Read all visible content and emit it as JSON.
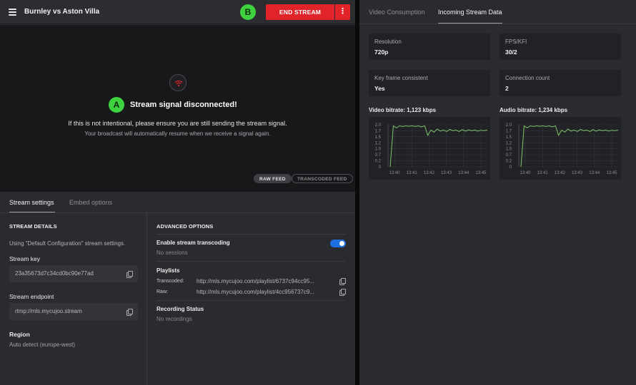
{
  "header": {
    "title": "Burnley vs Aston Villa",
    "badge_b": "B",
    "end_stream_label": "END STREAM",
    "more_label": "⋮"
  },
  "video": {
    "badge_a": "A",
    "title": "Stream signal disconnected!",
    "line1": "If this is not intentional, please ensure you are still sending the stream signal.",
    "line2": "Your broadcast will automatically resume when we receive a signal again.",
    "raw_feed": "RAW FEED",
    "transcoded_feed": "TRANSCODED FEED"
  },
  "left_tabs": [
    "Stream settings",
    "Embed options"
  ],
  "stream_details": {
    "heading": "STREAM DETAILS",
    "config_text": "Using \"Default Configuration\" stream settings.",
    "key_label": "Stream key",
    "key_value": "23a35673d7c34cd0bc90e77ad",
    "endpoint_label": "Stream endpoint",
    "endpoint_value": "rtmp://mls.mycujoo.stream",
    "region_label": "Region",
    "region_value": "Auto detect (europe-west)"
  },
  "advanced": {
    "heading": "ADVANCED OPTIONS",
    "transcoding_label": "Enable stream transcoding",
    "transcoding_enabled": true,
    "sessions": "No sessions",
    "playlists_label": "Playlists",
    "transcoded_label": "Transcoded:",
    "transcoded_url": "http://mls.mycujoo.com/playlist/6737c94cc95...",
    "raw_label": "Raw:",
    "raw_url": "http://mls.mycujoo.com/playlist/4cc956737c9...",
    "recording_label": "Recording Status",
    "recording_value": "No recordings"
  },
  "right_tabs": [
    "Video Consumption",
    "Incoming Stream Data"
  ],
  "stats": [
    {
      "label": "Resolution",
      "value": "720p"
    },
    {
      "label": "FPS/KFI",
      "value": "30/2"
    },
    {
      "label": "Key frame consistent",
      "value": "Yes"
    },
    {
      "label": "Connection count",
      "value": "2"
    }
  ],
  "colors": {
    "accent_red": "#e0242a",
    "badge_green": "#3ed23e",
    "toggle_blue": "#1e6fe0",
    "chart_line": "#7ec46a",
    "wifi_red": "#e0242a"
  },
  "chart_data": [
    {
      "type": "line",
      "title": "Video bitrate: 1,123 kbps",
      "x": [
        "13:40",
        "13:41",
        "13:42",
        "13:43",
        "13:44",
        "13:45"
      ],
      "y_ticks": [
        "2.0",
        "1.7",
        "1.5",
        "1.2",
        "1.0",
        "0.7",
        "0.2",
        "0"
      ],
      "ylim": [
        0,
        2.0
      ],
      "grid": true,
      "series": [
        {
          "values": [
            0,
            1.95,
            1.85,
            1.95,
            1.92,
            1.95,
            1.93,
            1.95,
            1.92,
            1.95,
            1.9,
            1.95,
            1.5,
            1.75,
            1.65,
            1.8,
            1.7,
            1.75,
            1.68,
            1.78,
            1.72,
            1.75,
            1.68,
            1.77,
            1.7,
            1.76,
            1.72,
            1.75,
            1.7,
            1.74,
            1.72,
            1.75
          ]
        }
      ]
    },
    {
      "type": "line",
      "title": "Audio bitrate: 1,234 kbps",
      "x": [
        "13:40",
        "13:41",
        "13:42",
        "13:43",
        "13:44",
        "13:45"
      ],
      "y_ticks": [
        "2.0",
        "1.7",
        "1.5",
        "1.2",
        "1.0",
        "0.7",
        "0.2",
        "0"
      ],
      "ylim": [
        0,
        2.0
      ],
      "grid": true,
      "series": [
        {
          "values": [
            0,
            1.95,
            1.85,
            1.95,
            1.92,
            1.95,
            1.93,
            1.95,
            1.92,
            1.95,
            1.9,
            1.95,
            1.5,
            1.75,
            1.65,
            1.8,
            1.7,
            1.75,
            1.68,
            1.78,
            1.72,
            1.75,
            1.68,
            1.77,
            1.7,
            1.76,
            1.72,
            1.75,
            1.7,
            1.74,
            1.72,
            1.75
          ]
        }
      ]
    }
  ]
}
